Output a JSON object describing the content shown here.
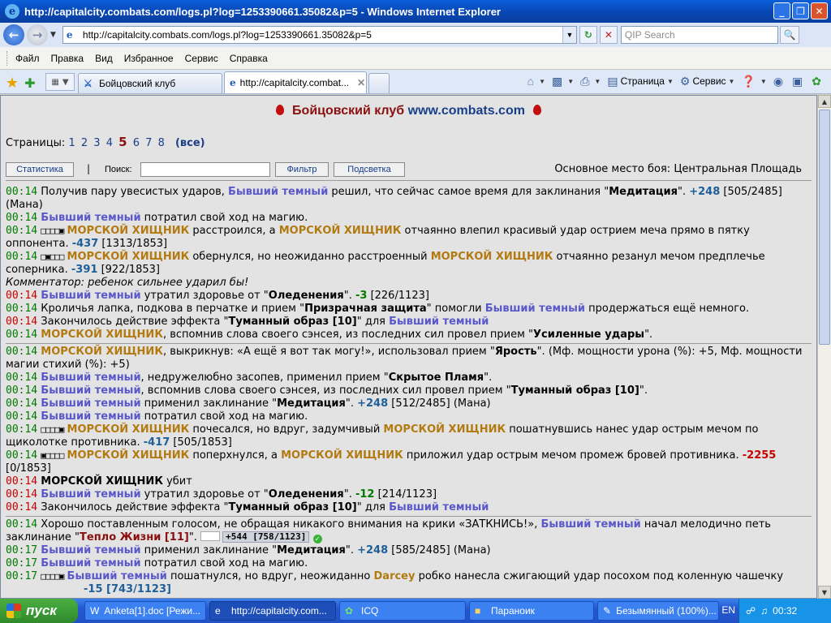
{
  "window": {
    "title": "http://capitalcity.combats.com/logs.pl?log=1253390661.35082&p=5 - Windows Internet Explorer",
    "minimize": "_",
    "maximize": "❐",
    "close": "✕"
  },
  "address": {
    "url": "http://capitalcity.combats.com/logs.pl?log=1253390661.35082&p=5",
    "search_placeholder": "QIP Search"
  },
  "menu": [
    "Файл",
    "Правка",
    "Вид",
    "Избранное",
    "Сервис",
    "Справка"
  ],
  "tabs": [
    {
      "label": "Бойцовский клуб"
    },
    {
      "label": "http://capitalcity.combat..."
    }
  ],
  "commands": {
    "page": "Страница",
    "tools": "Сервис"
  },
  "site": {
    "title": "Бойцовский клуб",
    "url": "www.combats.com"
  },
  "pager": {
    "label": "Страницы:",
    "pages": [
      "1",
      "2",
      "3",
      "4",
      "5",
      "6",
      "7",
      "8"
    ],
    "current": "5",
    "all": "(все)"
  },
  "controls": {
    "stats": "Статистика",
    "separator": "|",
    "search_label": "Поиск:",
    "filter": "Фильтр",
    "highlight": "Подсветка",
    "place": "Основное место боя: Центральная Площадь"
  },
  "log": {
    "l1_t": "00:14",
    "l1_a": "Получив пару увесистых ударов, ",
    "l1_n": "Бывший темный",
    "l1_b": " решил, что сейчас самое время для заклинания \"",
    "l1_s": "Медитация",
    "l1_c": "\". ",
    "l1_v": "+248",
    "l1_d": " [505/2485] (Мана)",
    "l2_t": "00:14",
    "l2_n": "Бывший темный",
    "l2_a": " потратил свой ход на магию.",
    "l3_t": "00:14",
    "l3_sq": "□□□□▣",
    "l3_n": "МОРСКОЙ ХИЩНИК",
    "l3_a": " расстроился, а ",
    "l3_n2": "МОРСКОЙ ХИЩНИК",
    "l3_b": " отчаянно влепил красивый удар острием меча прямо в пятку оппонента. ",
    "l3_v": "-437",
    "l3_c": " [1313/1853]",
    "l4_t": "00:14",
    "l4_sq": "□▣□□□",
    "l4_n": "МОРСКОЙ ХИЩНИК",
    "l4_a": " обернулся, но неожиданно расстроенный ",
    "l4_n2": "МОРСКОЙ ХИЩНИК",
    "l4_b": " отчаянно резанул мечом предплечье соперника. ",
    "l4_v": "-391",
    "l4_c": " [922/1853]",
    "l5": "Комментатор: ребенок сильнее ударил бы!",
    "l6_t": "00:14",
    "l6_n": "Бывший темный",
    "l6_a": " утратил здоровье от \"",
    "l6_s": "Оледенения",
    "l6_b": "\". ",
    "l6_v": "-3",
    "l6_c": " [226/1123]",
    "l7_t": "00:14",
    "l7_a": "Кроличья лапка, подкова в перчатке и прием \"",
    "l7_s": "Призрачная защита",
    "l7_b": "\" помогли ",
    "l7_n": "Бывший темный",
    "l7_c": " продержаться ещё немного.",
    "l8_t": "00:14",
    "l8_a": "Закончилось действие эффекта \"",
    "l8_s": "Туманный образ [10]",
    "l8_b": "\" для ",
    "l8_n": "Бывший темный",
    "l9_t": "00:14",
    "l9_n": "МОРСКОЙ ХИЩНИК",
    "l9_a": ", вспомнив слова своего сэнсея, из последних сил провел прием \"",
    "l9_s": "Усиленные удары",
    "l9_b": "\".",
    "l10_t": "00:14",
    "l10_n": "МОРСКОЙ ХИЩНИК",
    "l10_a": ", выкрикнув: «А ещё я вот так могу!», использовал прием \"",
    "l10_s": "Ярость",
    "l10_b": "\". (Мф. мощности урона (%): +5, Мф. мощности магии стихий (%): +5)",
    "l11_t": "00:14",
    "l11_n": "Бывший темный",
    "l11_a": ", недружелюбно засопев, применил прием \"",
    "l11_s": "Скрытое Пламя",
    "l11_b": "\".",
    "l12_t": "00:14",
    "l12_n": "Бывший темный",
    "l12_a": ", вспомнив слова своего сэнсея, из последних сил провел прием \"",
    "l12_s": "Туманный образ [10]",
    "l12_b": "\".",
    "l13_t": "00:14",
    "l13_n": "Бывший темный",
    "l13_a": " применил заклинание \"",
    "l13_s": "Медитация",
    "l13_b": "\". ",
    "l13_v": "+248",
    "l13_c": " [512/2485] (Мана)",
    "l14_t": "00:14",
    "l14_n": "Бывший темный",
    "l14_a": " потратил свой ход на магию.",
    "l15_t": "00:14",
    "l15_sq": "□□□□▣",
    "l15_n": "МОРСКОЙ ХИЩНИК",
    "l15_a": " почесался, но вдруг, задумчивый ",
    "l15_n2": "МОРСКОЙ ХИЩНИК",
    "l15_b": " пошатнувшись нанес удар острым мечом по щиколотке противника. ",
    "l15_v": "-417",
    "l15_c": " [505/1853]",
    "l16_t": "00:14",
    "l16_sq": "▣□□□□",
    "l16_n": "МОРСКОЙ ХИЩНИК",
    "l16_a": " поперхнулся, а ",
    "l16_n2": "МОРСКОЙ ХИЩНИК",
    "l16_b": " приложил удар острым мечом промеж бровей противника. ",
    "l16_v": "-2255",
    "l16_c": " [0/1853]",
    "l17_t": "00:14",
    "l17_n": "МОРСКОЙ ХИЩНИК",
    "l17_a": " убит",
    "l18_t": "00:14",
    "l18_n": "Бывший темный",
    "l18_a": " утратил здоровье от \"",
    "l18_s": "Оледенения",
    "l18_b": "\". ",
    "l18_v": "-12",
    "l18_c": " [214/1123]",
    "l19_t": "00:14",
    "l19_a": "Закончилось действие эффекта \"",
    "l19_s": "Туманный образ [10]",
    "l19_b": "\" для ",
    "l19_n": "Бывший темный",
    "l20_t": "00:14",
    "l20_a": "Хорошо поставленным голосом, не обращая никакого внимания на крики «ЗАТКНИСЬ!», ",
    "l20_n": "Бывший темный",
    "l20_b": " начал мелодично петь заклинание \"",
    "l20_s": "Тепло Жизни [11]",
    "l20_c": "\". ",
    "l20_tip": "+544 [758/1123]",
    "l21_t": "00:17",
    "l21_n": "Бывший темный",
    "l21_a": " применил заклинание \"",
    "l21_s": "Медитация",
    "l21_b": "\". ",
    "l21_v": "+248",
    "l21_c": " [585/2485] (Мана)",
    "l22_t": "00:17",
    "l22_n": "Бывший темный",
    "l22_a": " потратил свой ход на магию.",
    "l23_t": "00:17",
    "l23_sq": "□□□□▣",
    "l23_n": "Бывший темный",
    "l23_a": " пошатнулся, но вдруг, неожиданно ",
    "l23_n2": "Darcey",
    "l23_b": " робко нанесла сжигающий удар посохом под коленную чашечку",
    "l24": "-15 [743/1123]"
  },
  "taskbar": {
    "start": "пуск",
    "items": [
      "Anketa[1].doc [Режи...",
      "http://capitalcity.com...",
      "ICQ",
      "Параноик",
      "Безымянный (100%)..."
    ],
    "lang": "EN",
    "clock": "00:32"
  },
  "colors": {
    "accent": "#0a5fd8",
    "timestamp_green": "#007b00",
    "timestamp_red": "#c40000",
    "player_blue": "#5b59c9",
    "player_orange": "#b27a10"
  }
}
